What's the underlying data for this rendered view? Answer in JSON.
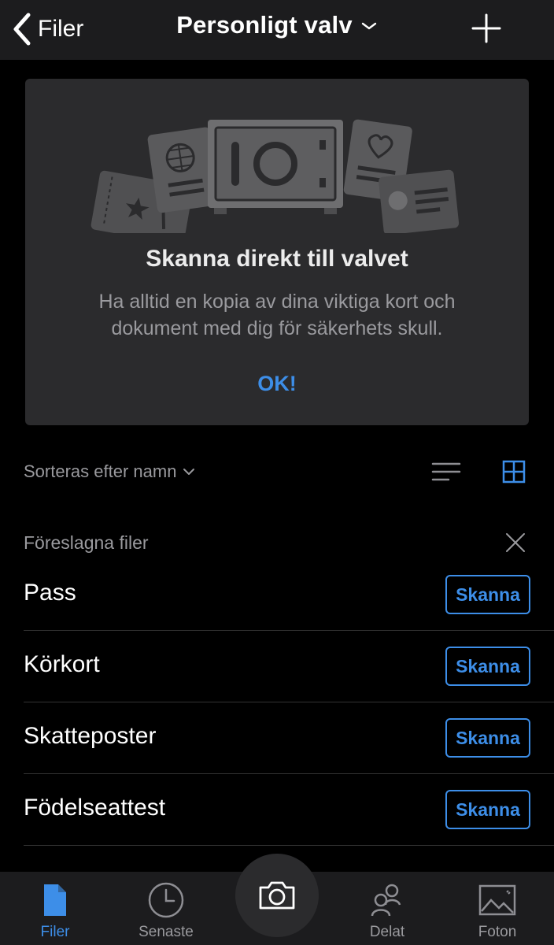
{
  "nav": {
    "back_label": "Filer",
    "title": "Personligt valv"
  },
  "promo": {
    "title": "Skanna direkt till valvet",
    "body": "Ha alltid en kopia av dina viktiga kort och dokument med dig för säkerhets skull.",
    "ok_label": "OK!"
  },
  "sort": {
    "label": "Sorteras efter namn"
  },
  "suggested": {
    "title": "Föreslagna filer",
    "items": [
      {
        "label": "Pass",
        "button": "Skanna"
      },
      {
        "label": "Körkort",
        "button": "Skanna"
      },
      {
        "label": "Skatteposter",
        "button": "Skanna"
      },
      {
        "label": "Födelseattest",
        "button": "Skanna"
      }
    ]
  },
  "tabs": [
    {
      "label": "Filer",
      "icon": "file-icon",
      "active": true
    },
    {
      "label": "Senaste",
      "icon": "clock-icon",
      "active": false
    },
    {
      "label": "Delat",
      "icon": "people-icon",
      "active": false
    },
    {
      "label": "Foton",
      "icon": "photo-icon",
      "active": false
    }
  ],
  "colors": {
    "accent": "#3d8ee8",
    "background": "#000000",
    "bar": "#1c1c1e",
    "card": "#2b2b2d",
    "muted_text": "#9a9a9e"
  }
}
